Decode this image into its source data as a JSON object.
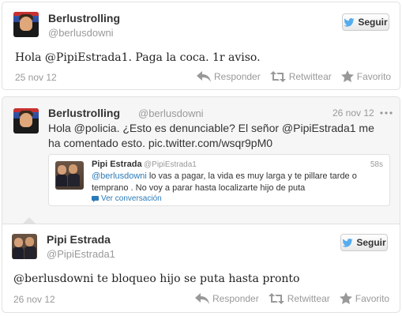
{
  "tweet1": {
    "name": "Berlustrolling",
    "handle": "@berlusdowni",
    "follow_label": "Seguir",
    "text": "Hola @PipiEstrada1. Paga la coca. 1r aviso.",
    "date": "25 nov 12",
    "actions": {
      "reply": "Responder",
      "retweet": "Retwittear",
      "favorite": "Favorito"
    }
  },
  "tweet2": {
    "name": "Berlustrolling",
    "handle": "@berlusdowni",
    "date": "26 nov 12",
    "text_line1": "Hola @policia. ¿Esto es denunciable? El señor @PipiEstrada1 me",
    "text_line2": "ha comentado esto. pic.twitter.com/wsqr9pM0",
    "embedded": {
      "name": "Pipi Estrada",
      "handle": "@PipiEstrada1",
      "time": "58s",
      "mention": "@berlusdowni",
      "text_rest": " lo vas a pagar, la vida es muy larga y te pillare tarde o",
      "text_line2": "temprano . No voy a parar hasta localizarte hijo de puta",
      "conversation_label": "Ver conversación"
    }
  },
  "tweet3": {
    "name": "Pipi Estrada",
    "handle": "@PipiEstrada1",
    "follow_label": "Seguir",
    "text": "@berlusdowni te bloqueo hijo se puta hasta pronto",
    "date": "26 nov 12",
    "actions": {
      "reply": "Responder",
      "retweet": "Retwittear",
      "favorite": "Favorito"
    }
  },
  "colors": {
    "link": "#2b7bb9",
    "muted": "#999999",
    "twitter_blue": "#55acee"
  },
  "icons": [
    "twitter-bird-icon",
    "reply-icon",
    "retweet-icon",
    "star-icon",
    "conversation-icon",
    "ellipsis-icon"
  ]
}
